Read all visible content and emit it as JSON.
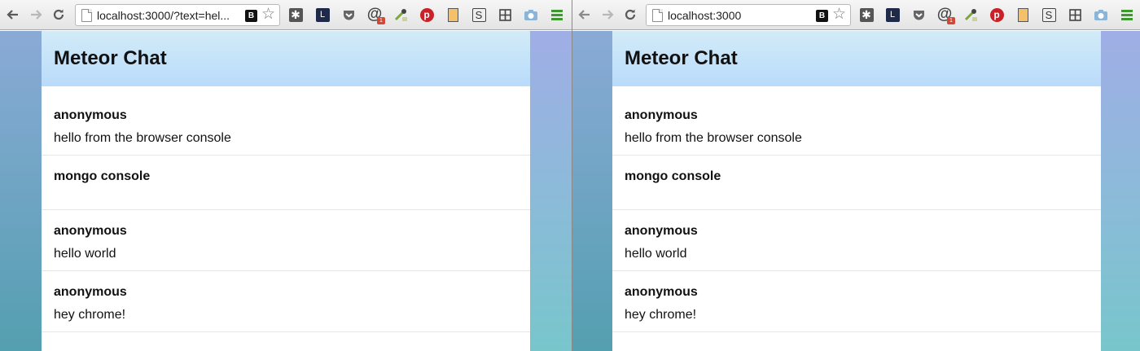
{
  "windows": [
    {
      "id": "left",
      "address_url": "localhost:3000/?text=hel...",
      "app_title": "Meteor Chat",
      "messages": [
        {
          "author": "anonymous",
          "text": "hello from the browser console"
        },
        {
          "author": "mongo console",
          "text": ""
        },
        {
          "author": "anonymous",
          "text": "hello world"
        },
        {
          "author": "anonymous",
          "text": "hey chrome!"
        }
      ]
    },
    {
      "id": "right",
      "address_url": "localhost:3000",
      "app_title": "Meteor Chat",
      "messages": [
        {
          "author": "anonymous",
          "text": "hello from the browser console"
        },
        {
          "author": "mongo console",
          "text": ""
        },
        {
          "author": "anonymous",
          "text": "hello world"
        },
        {
          "author": "anonymous",
          "text": "hey chrome!"
        }
      ]
    }
  ],
  "toolbar": {
    "bookmark_badge": "B",
    "extension_icons": [
      "asterisk-extension-icon",
      "lock-extension-icon",
      "pocket-icon",
      "mail-notifier-icon",
      "eyedropper-icon",
      "pinterest-icon",
      "bookmark-extension-icon",
      "s-extension-icon",
      "grid-extension-icon",
      "camera-icon",
      "chrome-menu-icon"
    ]
  },
  "colors": {
    "header_gradient_top": "#d2ebf7",
    "header_gradient_bottom": "#b9dbfb",
    "background_top": "#7aa3d2",
    "background_bottom": "#5ba6b5",
    "pinterest_red": "#cb2027",
    "menu_green": "#3c9a2d"
  }
}
